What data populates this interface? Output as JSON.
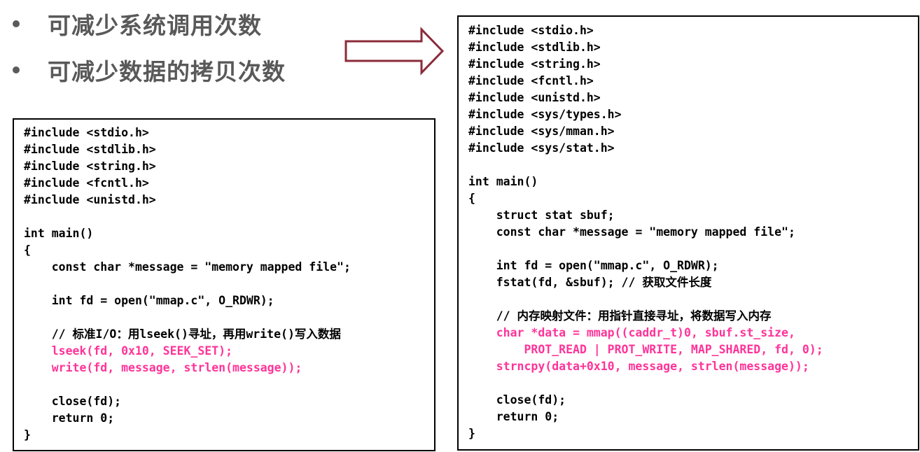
{
  "bullets": [
    "可减少系统调用次数",
    "可减少数据的拷贝次数"
  ],
  "colors": {
    "bullet_text": "#595959",
    "code_text": "#000000",
    "highlight": "#ff3399",
    "arrow": "#8b2b3a"
  },
  "left_code": {
    "lines": [
      {
        "text": "#include <stdio.h>",
        "style": "normal"
      },
      {
        "text": "#include <stdlib.h>",
        "style": "normal"
      },
      {
        "text": "#include <string.h>",
        "style": "normal"
      },
      {
        "text": "#include <fcntl.h>",
        "style": "normal"
      },
      {
        "text": "#include <unistd.h>",
        "style": "normal"
      },
      {
        "text": "",
        "style": "normal"
      },
      {
        "text": "int main()",
        "style": "normal"
      },
      {
        "text": "{",
        "style": "normal"
      },
      {
        "text": "    const char *message = \"memory mapped file\";",
        "style": "normal"
      },
      {
        "text": "",
        "style": "normal"
      },
      {
        "text": "    int fd = open(\"mmap.c\", O_RDWR);",
        "style": "normal"
      },
      {
        "text": "",
        "style": "normal"
      },
      {
        "text": "    // 标准I/O：用lseek()寻址，再用write()写入数据",
        "style": "normal"
      },
      {
        "text": "    lseek(fd, 0x10, SEEK_SET);",
        "style": "highlight"
      },
      {
        "text": "    write(fd, message, strlen(message));",
        "style": "highlight"
      },
      {
        "text": "",
        "style": "normal"
      },
      {
        "text": "    close(fd);",
        "style": "normal"
      },
      {
        "text": "    return 0;",
        "style": "normal"
      },
      {
        "text": "}",
        "style": "normal"
      }
    ]
  },
  "right_code": {
    "lines": [
      {
        "text": "#include <stdio.h>",
        "style": "normal"
      },
      {
        "text": "#include <stdlib.h>",
        "style": "normal"
      },
      {
        "text": "#include <string.h>",
        "style": "normal"
      },
      {
        "text": "#include <fcntl.h>",
        "style": "normal"
      },
      {
        "text": "#include <unistd.h>",
        "style": "normal"
      },
      {
        "text": "#include <sys/types.h>",
        "style": "normal"
      },
      {
        "text": "#include <sys/mman.h>",
        "style": "normal"
      },
      {
        "text": "#include <sys/stat.h>",
        "style": "normal"
      },
      {
        "text": "",
        "style": "normal"
      },
      {
        "text": "int main()",
        "style": "normal"
      },
      {
        "text": "{",
        "style": "normal"
      },
      {
        "text": "    struct stat sbuf;",
        "style": "normal"
      },
      {
        "text": "    const char *message = \"memory mapped file\";",
        "style": "normal"
      },
      {
        "text": "",
        "style": "normal"
      },
      {
        "text": "    int fd = open(\"mmap.c\", O_RDWR);",
        "style": "normal"
      },
      {
        "text": "    fstat(fd, &sbuf); // 获取文件长度",
        "style": "normal"
      },
      {
        "text": "",
        "style": "normal"
      },
      {
        "text": "    // 内存映射文件：用指针直接寻址，将数据写入内存",
        "style": "normal"
      },
      {
        "text": "    char *data = mmap((caddr_t)0, sbuf.st_size,",
        "style": "highlight"
      },
      {
        "text": "        PROT_READ | PROT_WRITE, MAP_SHARED, fd, 0);",
        "style": "highlight"
      },
      {
        "text": "    strncpy(data+0x10, message, strlen(message));",
        "style": "highlight"
      },
      {
        "text": "",
        "style": "normal"
      },
      {
        "text": "    close(fd);",
        "style": "normal"
      },
      {
        "text": "    return 0;",
        "style": "normal"
      },
      {
        "text": "}",
        "style": "normal"
      }
    ]
  }
}
